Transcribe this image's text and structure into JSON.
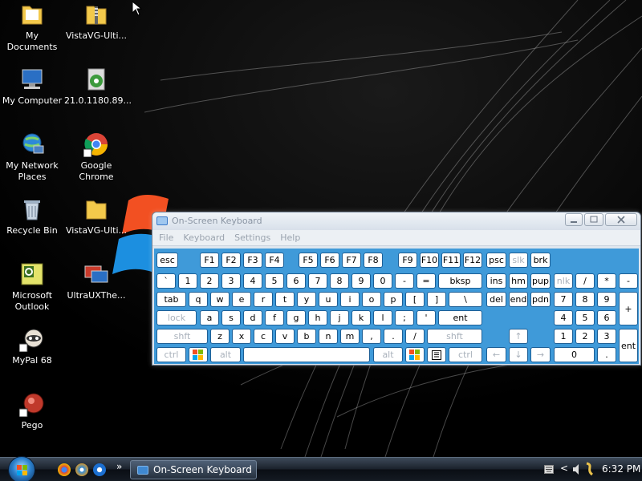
{
  "desktop": {
    "icons": [
      {
        "label": "My Documents",
        "icon": "folder-icon"
      },
      {
        "label": "VistaVG-Ulti...",
        "icon": "zip-folder-icon"
      },
      {
        "label": "My Computer",
        "icon": "computer-icon"
      },
      {
        "label": "21.0.1180.89...",
        "icon": "installer-icon"
      },
      {
        "label": "My Network Places",
        "icon": "network-icon"
      },
      {
        "label": "Google Chrome",
        "icon": "chrome-icon"
      },
      {
        "label": "Recycle Bin",
        "icon": "recycle-bin-icon"
      },
      {
        "label": "VistaVG-Ulti...",
        "icon": "folder-icon"
      },
      {
        "label": "Microsoft Outlook",
        "icon": "outlook-icon"
      },
      {
        "label": "UltraUXThe...",
        "icon": "display-icon"
      },
      {
        "label": "MyPal 68",
        "icon": "mypal-icon"
      },
      {
        "label": "Pego",
        "icon": "pego-icon"
      }
    ]
  },
  "osk": {
    "title": "On-Screen Keyboard",
    "menu": [
      "File",
      "Keyboard",
      "Settings",
      "Help"
    ],
    "keys": {
      "row1": [
        "esc",
        "F1",
        "F2",
        "F3",
        "F4",
        "F5",
        "F6",
        "F7",
        "F8",
        "F9",
        "F10",
        "F11",
        "F12",
        "psc",
        "slk",
        "brk"
      ],
      "row2": [
        "`",
        "1",
        "2",
        "3",
        "4",
        "5",
        "6",
        "7",
        "8",
        "9",
        "0",
        "-",
        "=",
        "bksp",
        "ins",
        "hm",
        "pup",
        "nlk",
        "/",
        "*",
        "-"
      ],
      "row3": [
        "tab",
        "q",
        "w",
        "e",
        "r",
        "t",
        "y",
        "u",
        "i",
        "o",
        "p",
        "[",
        "]",
        "\\",
        "del",
        "end",
        "pdn",
        "7",
        "8",
        "9",
        "+"
      ],
      "row4": [
        "lock",
        "a",
        "s",
        "d",
        "f",
        "g",
        "h",
        "j",
        "k",
        "l",
        ";",
        "'",
        "ent",
        "4",
        "5",
        "6"
      ],
      "row5": [
        "shft",
        "z",
        "x",
        "c",
        "v",
        "b",
        "n",
        "m",
        ",",
        ".",
        "/",
        "shft",
        "↑",
        "1",
        "2",
        "3",
        "ent"
      ],
      "row6": [
        "ctrl",
        "",
        "alt",
        "",
        "alt",
        "",
        "",
        "ctrl",
        "←",
        "↓",
        "→",
        "0",
        "."
      ]
    }
  },
  "taskbar": {
    "task_label": "On-Screen Keyboard",
    "overflow": "»",
    "tray_chevron": "<",
    "time": "6:32 PM"
  },
  "colors": {
    "key_area": "#3f9ad9",
    "key_border": "#1d5f96",
    "dim_text": "#a9b1bb"
  }
}
